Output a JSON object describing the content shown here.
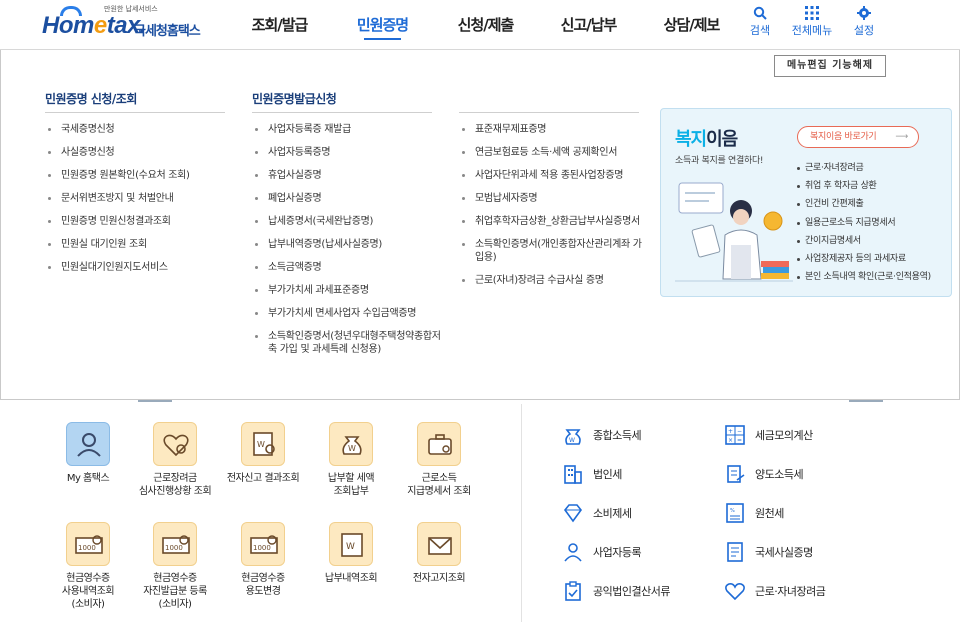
{
  "header": {
    "logo_tag": "만원한 납세서비스",
    "logo_home": "Hom",
    "logo_e": "e",
    "logo_tax": "tax.",
    "logo_sub": "국세청홈택스",
    "nav": [
      "조회/발급",
      "민원증명",
      "신청/제출",
      "신고/납부",
      "상담/제보"
    ],
    "active_nav": "민원증명",
    "utils": {
      "search": "검색",
      "all_menu": "전체메뉴",
      "settings": "설정"
    }
  },
  "panel": {
    "edit_button": "메뉴편집 기능해제",
    "col1": {
      "title": "민원증명 신청/조회",
      "items": [
        "국세증명신청",
        "사실증명신청",
        "민원증명 원본확인(수요처 조회)",
        "문서위변조방지 및 처벌안내",
        "민원증명 민원신청결과조회",
        "민원실 대기인원 조회",
        "민원실대기인원지도서비스"
      ]
    },
    "col2": {
      "title": "민원증명발급신청",
      "items": [
        "사업자등록증 재발급",
        "사업자등록증명",
        "휴업사실증명",
        "폐업사실증명",
        "납세증명서(국세완납증명)",
        "납부내역증명(납세사실증명)",
        "소득금액증명",
        "부가가치세 과세표준증명",
        "부가가치세 면세사업자 수입금액증명",
        "소득확인증명서(청년우대형주택청약종합저축 가입 및 과세특례 신청용)"
      ]
    },
    "col3": {
      "items": [
        "표준재무제표증명",
        "연금보험료등 소득·세액 공제확인서",
        "사업자단위과세 적용 종된사업장증명",
        "모범납세자증명",
        "취업후학자금상환_상환금납부사실증명서",
        "소득확인증명서(개인종합자산관리계좌 가입용)",
        "근로(자녀)장려금 수급사실 증명"
      ]
    },
    "welfare": {
      "title_hl": "복지",
      "title_rest": "이음",
      "subtitle": "소득과 복지를 연결하다!",
      "go_button": "복지이음 바로가기",
      "go_arrow": "⟶",
      "items": [
        "근로·자녀장려금",
        "취업 후 학자금 상환",
        "인건비 간편제출",
        "일용근로소득 지급명세서",
        "간이지급명세서",
        "사업장제공자 등의 과세자료",
        "본인 소득내역 확인(근로·인적용역)"
      ]
    }
  },
  "services": [
    {
      "label": "My 홈택스",
      "icon": "user-icon"
    },
    {
      "label": "근로장려금\n심사진행상황 조회",
      "icon": "heart-magnifier-icon"
    },
    {
      "label": "전자신고 결과조회",
      "icon": "document-search-icon"
    },
    {
      "label": "납부할 세액\n조회납부",
      "icon": "money-bag-icon"
    },
    {
      "label": "근로소득\n지급명세서 조회",
      "icon": "briefcase-icon"
    },
    {
      "label": "현금영수증\n사용내역조회\n(소비자)",
      "icon": "receipt-search-icon"
    },
    {
      "label": "현금영수증\n자진발급분 등록\n(소비자)",
      "icon": "receipt-register-icon"
    },
    {
      "label": "현금영수증\n용도변경",
      "icon": "receipt-change-icon"
    },
    {
      "label": "납부내역조회",
      "icon": "payment-history-icon"
    },
    {
      "label": "전자고지조회",
      "icon": "envelope-icon"
    }
  ],
  "taxes": [
    {
      "label": "종합소득세",
      "icon": "income-tax-icon"
    },
    {
      "label": "세금모의계산",
      "icon": "calculator-icon"
    },
    {
      "label": "법인세",
      "icon": "building-icon"
    },
    {
      "label": "양도소득세",
      "icon": "transfer-icon"
    },
    {
      "label": "소비제세",
      "icon": "diamond-icon"
    },
    {
      "label": "원천세",
      "icon": "withholding-icon"
    },
    {
      "label": "사업자등록",
      "icon": "person-icon"
    },
    {
      "label": "국세사실증명",
      "icon": "certificate-icon"
    },
    {
      "label": "공익법인결산서류",
      "icon": "clipboard-icon"
    },
    {
      "label": "근로·자녀장려금",
      "icon": "heart-icon"
    }
  ],
  "colors": {
    "accent": "#1e6bd6",
    "navy": "#1a3e7a",
    "welfare_bg": "#e9f5fb",
    "service_bg": "#fde9c1"
  }
}
